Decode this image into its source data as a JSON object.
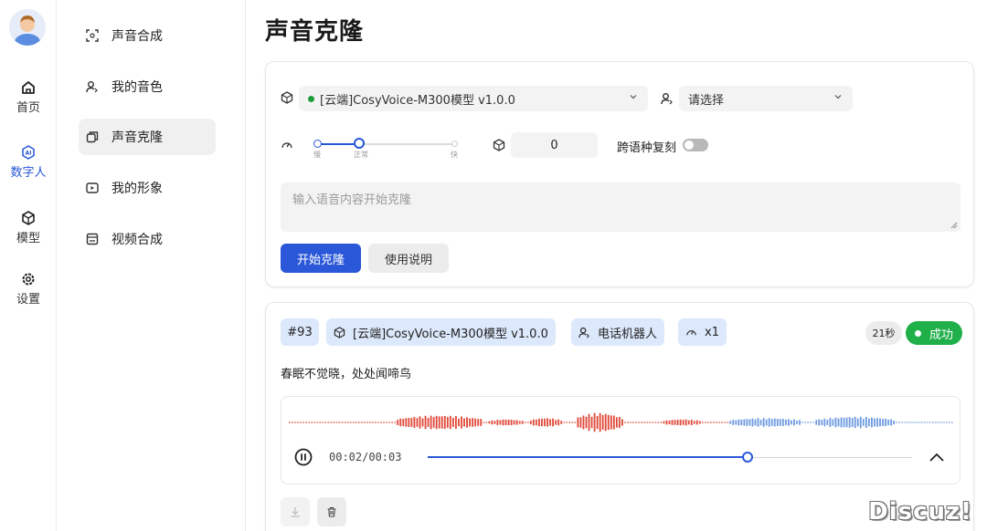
{
  "rail": {
    "items": [
      {
        "label": "首页",
        "icon": "home-icon"
      },
      {
        "label": "数字人",
        "icon": "ai-icon",
        "active": true
      },
      {
        "label": "模型",
        "icon": "cube-icon"
      },
      {
        "label": "设置",
        "icon": "gear-icon"
      }
    ]
  },
  "menu": {
    "items": [
      {
        "label": "声音合成",
        "icon": "scan-icon"
      },
      {
        "label": "我的音色",
        "icon": "user-voice-icon"
      },
      {
        "label": "声音克隆",
        "icon": "clone-icon",
        "active": true
      },
      {
        "label": "我的形象",
        "icon": "image-icon"
      },
      {
        "label": "视频合成",
        "icon": "video-icon"
      }
    ]
  },
  "page": {
    "title": "声音克隆"
  },
  "form": {
    "model_select": "[云端]CosyVoice-M300模型 v1.0.0",
    "voice_select_placeholder": "请选择",
    "speed": {
      "labels": [
        "慢",
        "正常",
        "快"
      ],
      "value": 0.5
    },
    "seed_value": "0",
    "cross_lang_label": "跨语种复刻",
    "cross_lang_enabled": false,
    "text_placeholder": "输入语音内容开始克隆",
    "start_button": "开始克隆",
    "help_button": "使用说明"
  },
  "task": {
    "id": "#93",
    "model": "[云端]CosyVoice-M300模型 v1.0.0",
    "voice": "电话机器人",
    "speed": "x1",
    "duration": "21秒",
    "status": "成功",
    "text": "春眠不觉晓，处处闻啼鸟",
    "player": {
      "time": "00:02/00:03",
      "progress": 0.66
    }
  },
  "colors": {
    "accent": "#2b58d8",
    "success": "#1fb04a",
    "wave_played": "#e0493a",
    "wave_unplayed": "#6e9be0"
  },
  "watermark": "Discuz!"
}
